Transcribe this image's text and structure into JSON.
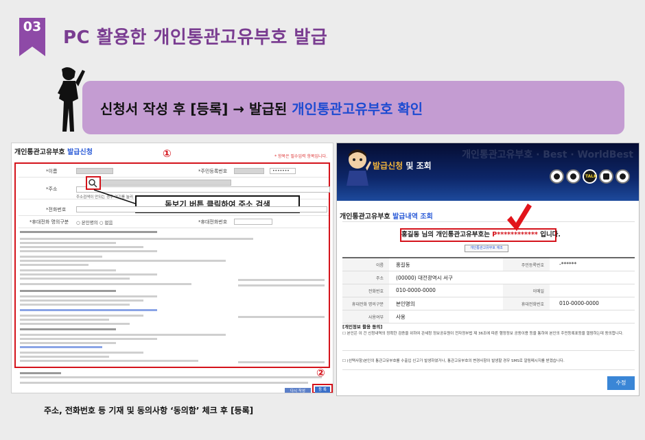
{
  "header": {
    "step_number": "03",
    "title": "PC 활용한  개인통관고유부호  발급"
  },
  "banner": {
    "text_prefix": "신청서 작성 후 [등록] → 발급된 ",
    "text_highlight": "개인통관고유부호 확인"
  },
  "left_panel": {
    "title_prefix": "개인통관고유부호 ",
    "title_highlight": "발급신청",
    "required_note": "* 항목은 필수입력 항목입니다.",
    "marker_1": "①",
    "marker_2": "②",
    "rows": [
      {
        "label": "*이름",
        "label2": "*주민등록번호",
        "value2": "•••••••"
      },
      {
        "label": "*주소"
      },
      {
        "label": "*전화번호"
      },
      {
        "label": "*휴대전화 명의구분",
        "options": "○ 본인명의  ○ 없음",
        "label2": "*휴대전화번호"
      }
    ],
    "address_hint": "주소검색이 안되는 경우 여기를 눌러",
    "callout": "돋보기 버튼 클릭하여 주소 검색",
    "buttons": {
      "cancel": "다시 작성",
      "submit": "등 록"
    },
    "caption": "주소, 전화번호 등 기재 및 동의사항 ‘동의함’ 체크 후 [등록]"
  },
  "right_panel": {
    "header_title_gold": "발급신청",
    "header_title_white_1": "및 조회",
    "header_bg_text": "개인통관고유부호 · Best · WorldBest",
    "page_title_prefix": "개인통관고유부호 ",
    "page_title_highlight": "발급내역 조회",
    "result_prefix": "홍길동 님의 개인통관고유부호는 ",
    "result_code": "P************",
    "result_suffix": " 입니다.",
    "print_button": "개인통관고유부호 재조",
    "table": [
      {
        "k1": "이름",
        "v1": "홍길동",
        "k2": "주민등록번호",
        "v2": "-******"
      },
      {
        "k1": "주소",
        "v1": "(00000) 대전광역시 서구"
      },
      {
        "k1": "전화번호",
        "v1": "010-0000-0000",
        "k2": "이메일",
        "v2": ""
      },
      {
        "k1": "휴대전화 명의구분",
        "v1": "본인명의",
        "k2": "휴대전화번호",
        "v2": "010-0000-0000"
      },
      {
        "k1": "사용여부",
        "v1": "사용"
      }
    ],
    "notice_head": "[개인정보 활용 동의]",
    "notice_1": "☐ 본인은 이 건 신청내역의 정확한 검증을 위하여 관세청 정보공유원이 전자정부법 제 36조에 따른 행정정보 공동이용 등을 통하여 본인의 주민등록표등을 열람하는데 동의합니다.",
    "notice_2": "☐ (선택사항)본인의 통관고유부호를 수출입 신고가 발생하였거나, 통관고유부호의 변경사항이 발생할 경우 SMS로 알림메시지를 받겠습니다.",
    "submit_button": "수정"
  }
}
